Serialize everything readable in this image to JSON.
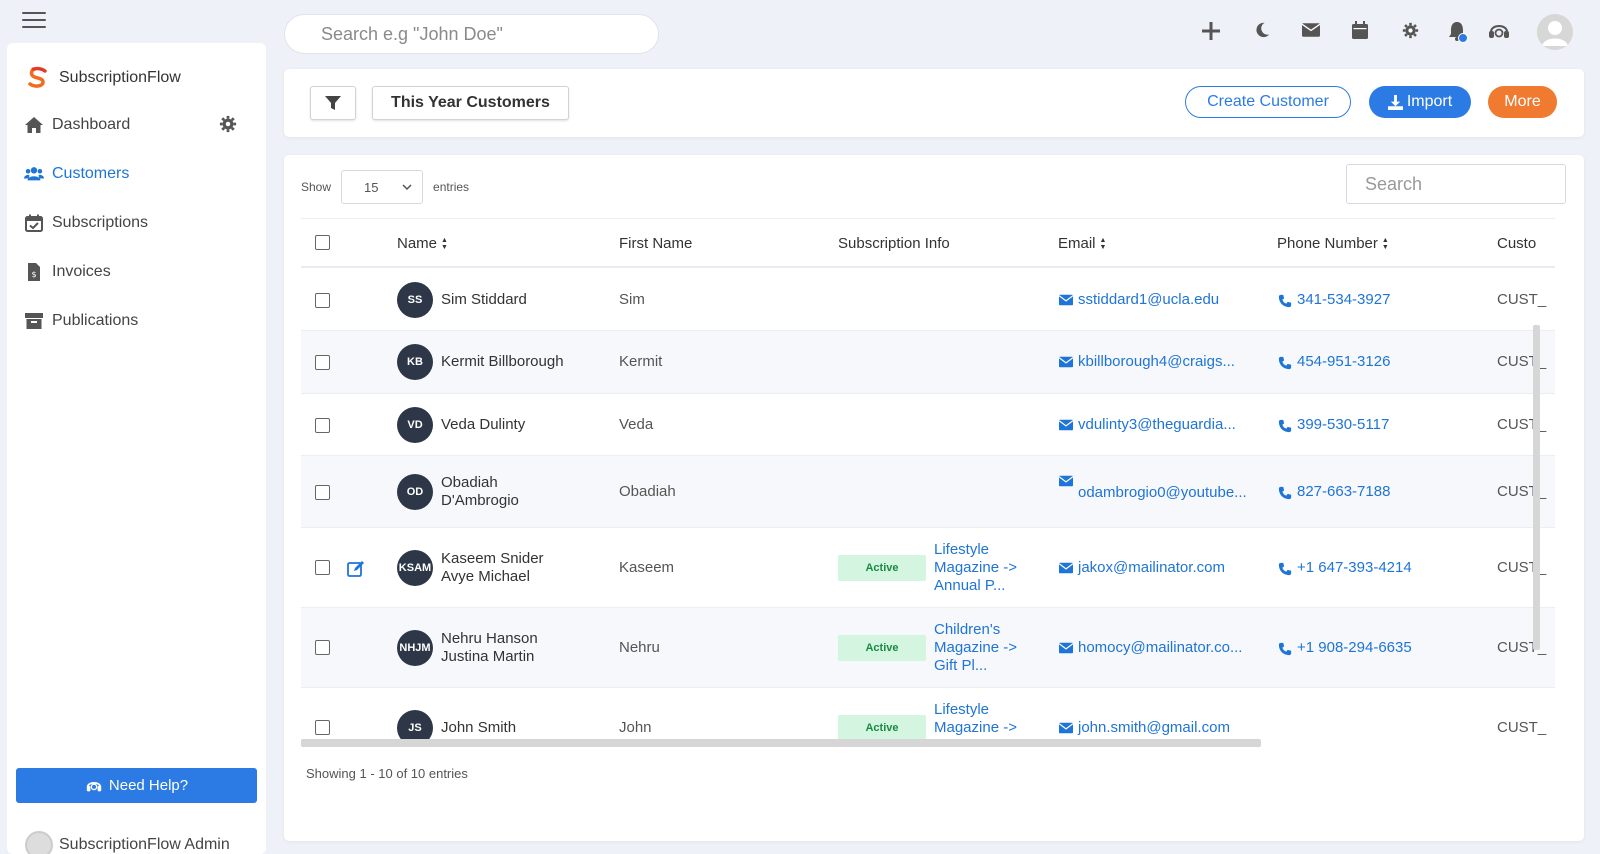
{
  "app": {
    "brand": "SubscriptionFlow"
  },
  "topbar": {
    "search_placeholder": "Search e.g \"John Doe\""
  },
  "sidebar": {
    "items": [
      {
        "label": "Dashboard",
        "icon": "home-icon"
      },
      {
        "label": "Customers",
        "icon": "users-icon",
        "active": true
      },
      {
        "label": "Subscriptions",
        "icon": "calendar-check-icon"
      },
      {
        "label": "Invoices",
        "icon": "invoice-icon"
      },
      {
        "label": "Publications",
        "icon": "archive-icon"
      }
    ],
    "help_label": "Need Help?",
    "admin_name": "SubscriptionFlow Admin"
  },
  "toolbar": {
    "view_label": "This Year Customers",
    "create_label": "Create Customer",
    "import_label": "Import",
    "more_label": "More"
  },
  "table": {
    "show_label": "Show",
    "entries_label": "entries",
    "page_size": "15",
    "search_placeholder": "Search",
    "columns": [
      "Name",
      "First Name",
      "Subscription Info",
      "Email",
      "Phone Number",
      "Custo"
    ],
    "rows": [
      {
        "initials": "SS",
        "name": "Sim Stiddard",
        "first": "Sim",
        "status": "",
        "subscription": "",
        "email": "sstiddard1@ucla.edu",
        "phone": "341-534-3927",
        "cust": "CUST_"
      },
      {
        "initials": "KB",
        "name": "Kermit Billborough",
        "first": "Kermit",
        "status": "",
        "subscription": "",
        "email": "kbillborough4@craigs...",
        "phone": "454-951-3126",
        "cust": "CUST_"
      },
      {
        "initials": "VD",
        "name": "Veda Dulinty",
        "first": "Veda",
        "status": "",
        "subscription": "",
        "email": "vdulinty3@theguardia...",
        "phone": "399-530-5117",
        "cust": "CUST_"
      },
      {
        "initials": "OD",
        "name": "Obadiah D'Ambrogio",
        "first": "Obadiah",
        "status": "",
        "subscription": "",
        "email": "odambrogio0@youtube...",
        "phone": "827-663-7188",
        "cust": "CUST_"
      },
      {
        "initials": "KSAM",
        "name": "Kaseem Snider Avye Michael",
        "first": "Kaseem",
        "status": "Active",
        "subscription": "Lifestyle Magazine -> Annual P...",
        "email": "jakox@mailinator.com",
        "phone": "+1 647-393-4214",
        "cust": "CUST_"
      },
      {
        "initials": "NHJM",
        "name": "Nehru Hanson Justina Martin",
        "first": "Nehru",
        "status": "Active",
        "subscription": "Children's Magazine -> Gift Pl...",
        "email": "homocy@mailinator.co...",
        "phone": "+1 908-294-6635",
        "cust": "CUST_"
      },
      {
        "initials": "JS",
        "name": "John Smith",
        "first": "John",
        "status": "Active",
        "subscription": "Lifestyle Magazine ->",
        "email": "john.smith@gmail.com",
        "phone": "",
        "cust": "CUST_"
      }
    ],
    "footer": "Showing 1 - 10 of 10 entries"
  },
  "colors": {
    "accent": "#2c7be5",
    "more": "#f07a30",
    "active_badge_bg": "#d4f5df",
    "active_badge_text": "#1a8b45"
  }
}
